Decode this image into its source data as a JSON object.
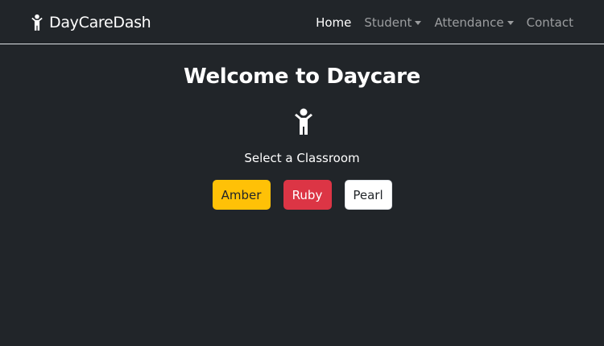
{
  "navbar": {
    "brand": "DayCareDash",
    "brand_icon": "child-icon",
    "links": {
      "home": "Home",
      "student": "Student",
      "attendance": "Attendance",
      "contact": "Contact"
    }
  },
  "main": {
    "title": "Welcome to Daycare",
    "hero_icon": "child-icon",
    "subtitle": "Select a Classroom",
    "classrooms": {
      "amber": "Amber",
      "ruby": "Ruby",
      "pearl": "Pearl"
    }
  },
  "colors": {
    "background": "#212529",
    "amber": "#ffc107",
    "ruby": "#dc3545",
    "pearl": "#ffffff"
  }
}
